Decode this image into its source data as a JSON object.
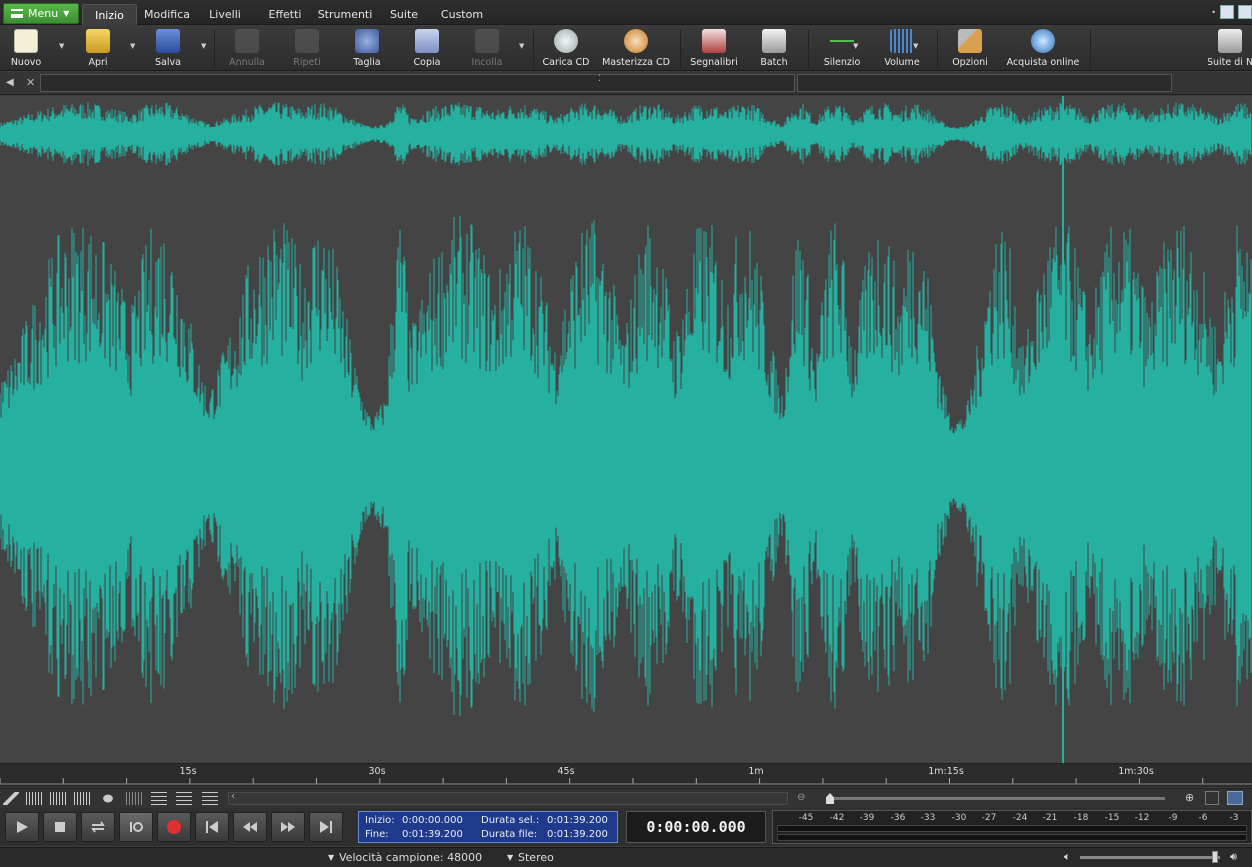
{
  "menu": {
    "label": "Menu"
  },
  "tabs": [
    {
      "label": "Inizio",
      "active": true
    },
    {
      "label": "Modifica"
    },
    {
      "label": "Livelli"
    },
    {
      "label": "Effetti"
    },
    {
      "label": "Strumenti"
    },
    {
      "label": "Suite"
    },
    {
      "label": "Custom"
    }
  ],
  "toolbar": {
    "nuovo": "Nuovo",
    "apri": "Apri",
    "salva": "Salva",
    "annulla": "Annulla",
    "ripeti": "Ripeti",
    "taglia": "Taglia",
    "copia": "Copia",
    "incolla": "Incolla",
    "carica_cd": "Carica CD",
    "masterizza_cd": "Masterizza CD",
    "segnalibri": "Segnalibri",
    "batch": "Batch",
    "silenzio": "Silenzio",
    "volume": "Volume",
    "opzioni": "Opzioni",
    "acquista_online": "Acquista online",
    "suite_di": "Suite di N"
  },
  "timeline": {
    "ticks": [
      "15s",
      "30s",
      "45s",
      "1m",
      "1m:15s",
      "1m:30s"
    ]
  },
  "selection": {
    "inizio_label": "Inizio:",
    "inizio": "0:00:00.000",
    "fine_label": "Fine:",
    "fine": "0:01:39.200",
    "durata_sel_label": "Durata sel.:",
    "durata_sel": "0:01:39.200",
    "durata_file_label": "Durata file:",
    "durata_file": "0:01:39.200"
  },
  "time_display": "0:00:00.000",
  "meter": {
    "scale": [
      "-45",
      "-42",
      "-39",
      "-36",
      "-33",
      "-30",
      "-27",
      "-24",
      "-21",
      "-18",
      "-15",
      "-12",
      "-9",
      "-6",
      "-3"
    ]
  },
  "status": {
    "sample_rate": "Velocità campione: 48000",
    "channels": "Stereo"
  },
  "colors": {
    "waveform": "#26b0a0",
    "background": "#444444",
    "accent_green": "#4aa63e",
    "selection_blue": "#1f3a8a",
    "record_red": "#e03030"
  }
}
